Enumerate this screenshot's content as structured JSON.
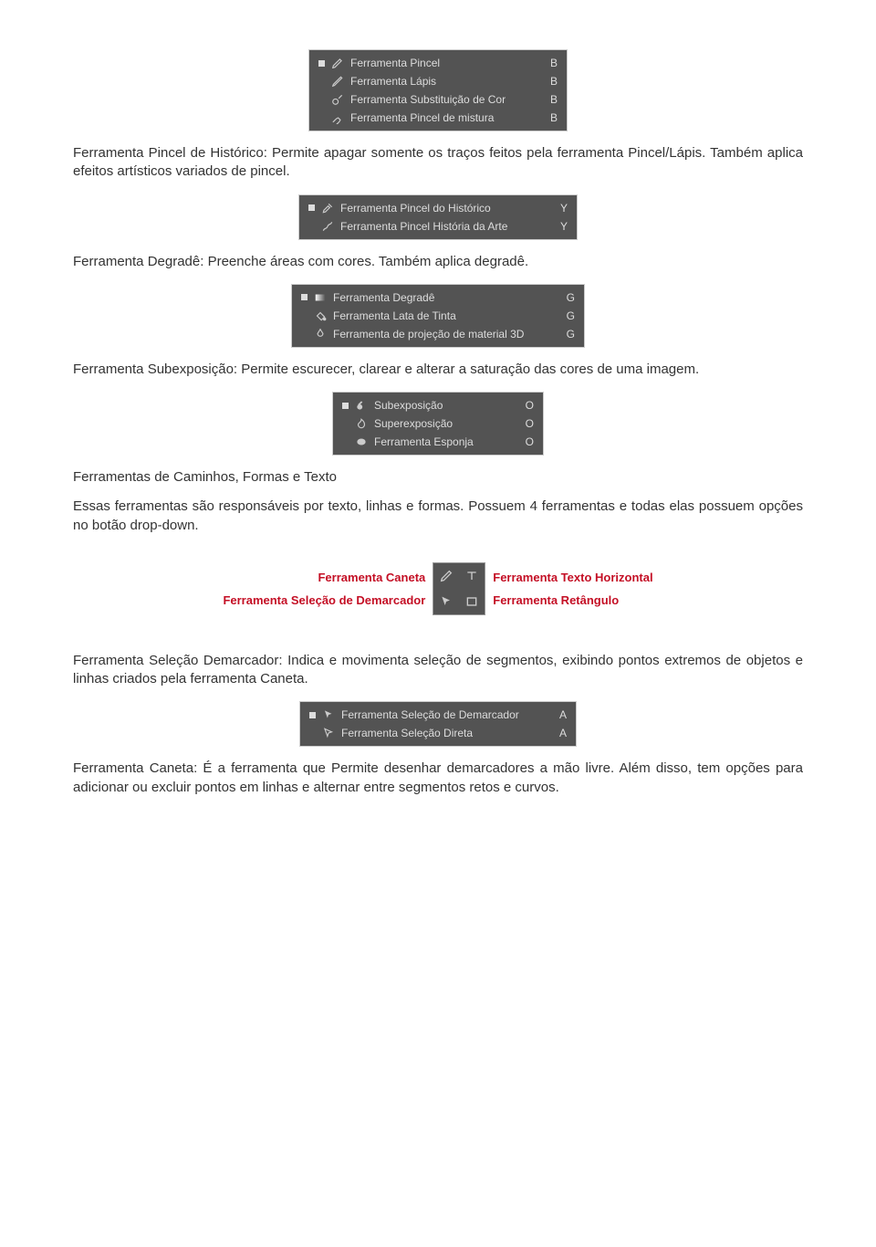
{
  "menus": {
    "pincel": [
      {
        "label": "Ferramenta Pincel",
        "shortcut": "B",
        "selected": true
      },
      {
        "label": "Ferramenta Lápis",
        "shortcut": "B",
        "selected": false
      },
      {
        "label": "Ferramenta Substituição de Cor",
        "shortcut": "B",
        "selected": false
      },
      {
        "label": "Ferramenta Pincel de mistura",
        "shortcut": "B",
        "selected": false
      }
    ],
    "historico": [
      {
        "label": "Ferramenta Pincel do Histórico",
        "shortcut": "Y",
        "selected": true
      },
      {
        "label": "Ferramenta Pincel História da Arte",
        "shortcut": "Y",
        "selected": false
      }
    ],
    "degrade": [
      {
        "label": "Ferramenta Degradê",
        "shortcut": "G",
        "selected": true
      },
      {
        "label": "Ferramenta Lata de Tinta",
        "shortcut": "G",
        "selected": false
      },
      {
        "label": "Ferramenta de projeção de material 3D",
        "shortcut": "G",
        "selected": false
      }
    ],
    "subexposicao": [
      {
        "label": "Subexposição",
        "shortcut": "O",
        "selected": true
      },
      {
        "label": "Superexposição",
        "shortcut": "O",
        "selected": false
      },
      {
        "label": "Ferramenta Esponja",
        "shortcut": "O",
        "selected": false
      }
    ],
    "demarcador": [
      {
        "label": "Ferramenta Seleção de Demarcador",
        "shortcut": "A",
        "selected": true
      },
      {
        "label": "Ferramenta Seleção Direta",
        "shortcut": "A",
        "selected": false
      }
    ]
  },
  "toolgrid": {
    "left_top": "Ferramenta Caneta",
    "left_bottom": "Ferramenta Seleção de Demarcador",
    "right_top": "Ferramenta Texto Horizontal",
    "right_bottom": "Ferramenta Retângulo"
  },
  "paragraphs": {
    "p1": "Ferramenta Pincel de Histórico: Permite apagar somente os traços feitos pela ferramenta Pincel/Lápis. Também aplica efeitos artísticos variados de pincel.",
    "p2": "Ferramenta Degradê: Preenche áreas com cores. Também aplica degradê.",
    "p3": "Ferramenta Subexposição: Permite escurecer, clarear e alterar a saturação das cores de uma imagem.",
    "p4": "Ferramentas de Caminhos, Formas e Texto",
    "p5": "Essas ferramentas são responsáveis por texto, linhas e formas. Possuem 4 ferramentas e todas elas possuem opções no botão drop-down.",
    "p6": "Ferramenta Seleção Demarcador: Indica e movimenta seleção de segmentos, exibindo pontos extremos de objetos e linhas criados pela ferramenta Caneta.",
    "p7": "Ferramenta Caneta: É a ferramenta que Permite desenhar demarcadores a mão livre. Além disso, tem opções para adicionar ou excluir pontos em linhas e alternar entre segmentos retos e curvos."
  }
}
